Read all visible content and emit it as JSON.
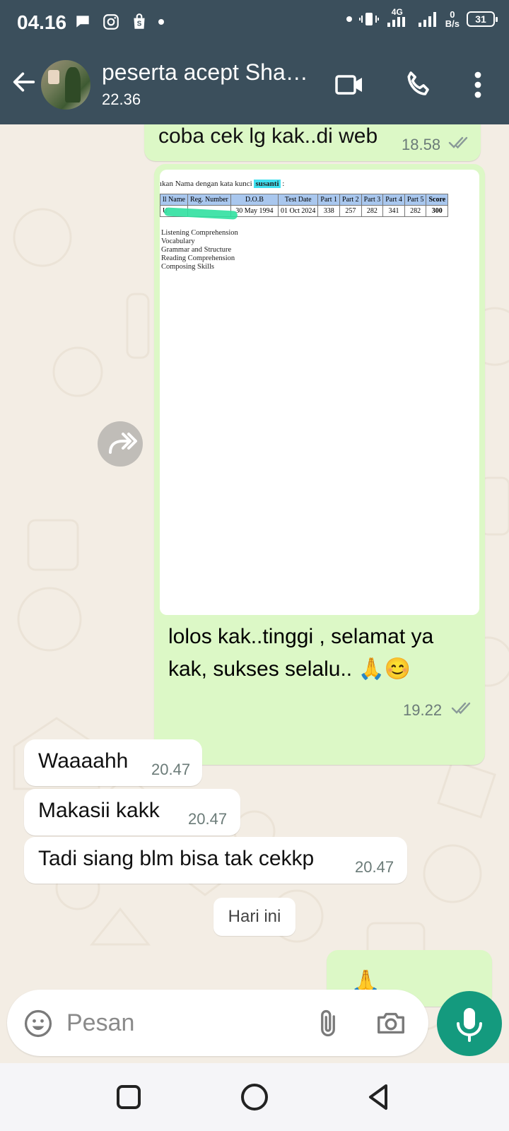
{
  "status_bar": {
    "time": "04.16",
    "network_type": "4G",
    "net_speed_value": "0",
    "net_speed_unit": "B/s",
    "battery": "31"
  },
  "header": {
    "contact_name": "peserta acept Sha…",
    "last_seen": "22.36"
  },
  "messages": [
    {
      "direction": "out",
      "text": "coba cek lg kak..di web",
      "time": "18.58",
      "status": "read"
    },
    {
      "direction": "out",
      "type": "image",
      "image": {
        "caption_prefix": "ıkan Nama dengan kata kunci",
        "caption_keyword": "susanti",
        "caption_suffix": ":",
        "table_headers": [
          "ll Name",
          "Reg. Number",
          "D.O.B",
          "Test Date",
          "Part 1",
          "Part 2",
          "Part 3",
          "Part 4",
          "Part 5",
          "Score"
        ],
        "table_row": [
          "U",
          "",
          "30 May 1994",
          "01 Oct 2024",
          "338",
          "257",
          "282",
          "341",
          "282",
          "300"
        ],
        "skills": [
          "Listening Comprehension",
          "Vocabulary",
          "Grammar and Structure",
          "Reading Comprehension",
          "Composing Skills"
        ]
      },
      "text_line1": "lolos kak..tinggi , selamat ya",
      "text_line2": "kak, sukses selalu..",
      "emojis": "🙏😊",
      "time": "19.22",
      "status": "read"
    },
    {
      "direction": "in",
      "text": "Waaaahh",
      "time": "20.47"
    },
    {
      "direction": "in",
      "text": "Makasii kakk",
      "time": "20.47"
    },
    {
      "direction": "in",
      "text": "Tadi siang blm bisa tak cekkp",
      "time": "20.47"
    }
  ],
  "date_divider": "Hari ini",
  "partial_message": {
    "direction": "out",
    "emoji": "🙏"
  },
  "input": {
    "placeholder": "Pesan"
  },
  "colors": {
    "header_bg": "#3b4f5c",
    "outgoing_bubble": "#dcf8c6",
    "incoming_bubble": "#ffffff",
    "accent": "#149a7e",
    "read_ticks": "#8a9a98",
    "chat_bg": "#f3ede4"
  },
  "icons": [
    "back-arrow-icon",
    "video-call-icon",
    "phone-icon",
    "more-vert-icon",
    "emoji-icon",
    "attach-icon",
    "camera-icon",
    "mic-icon",
    "forward-icon",
    "nav-recents-icon",
    "nav-home-icon",
    "nav-back-icon"
  ]
}
